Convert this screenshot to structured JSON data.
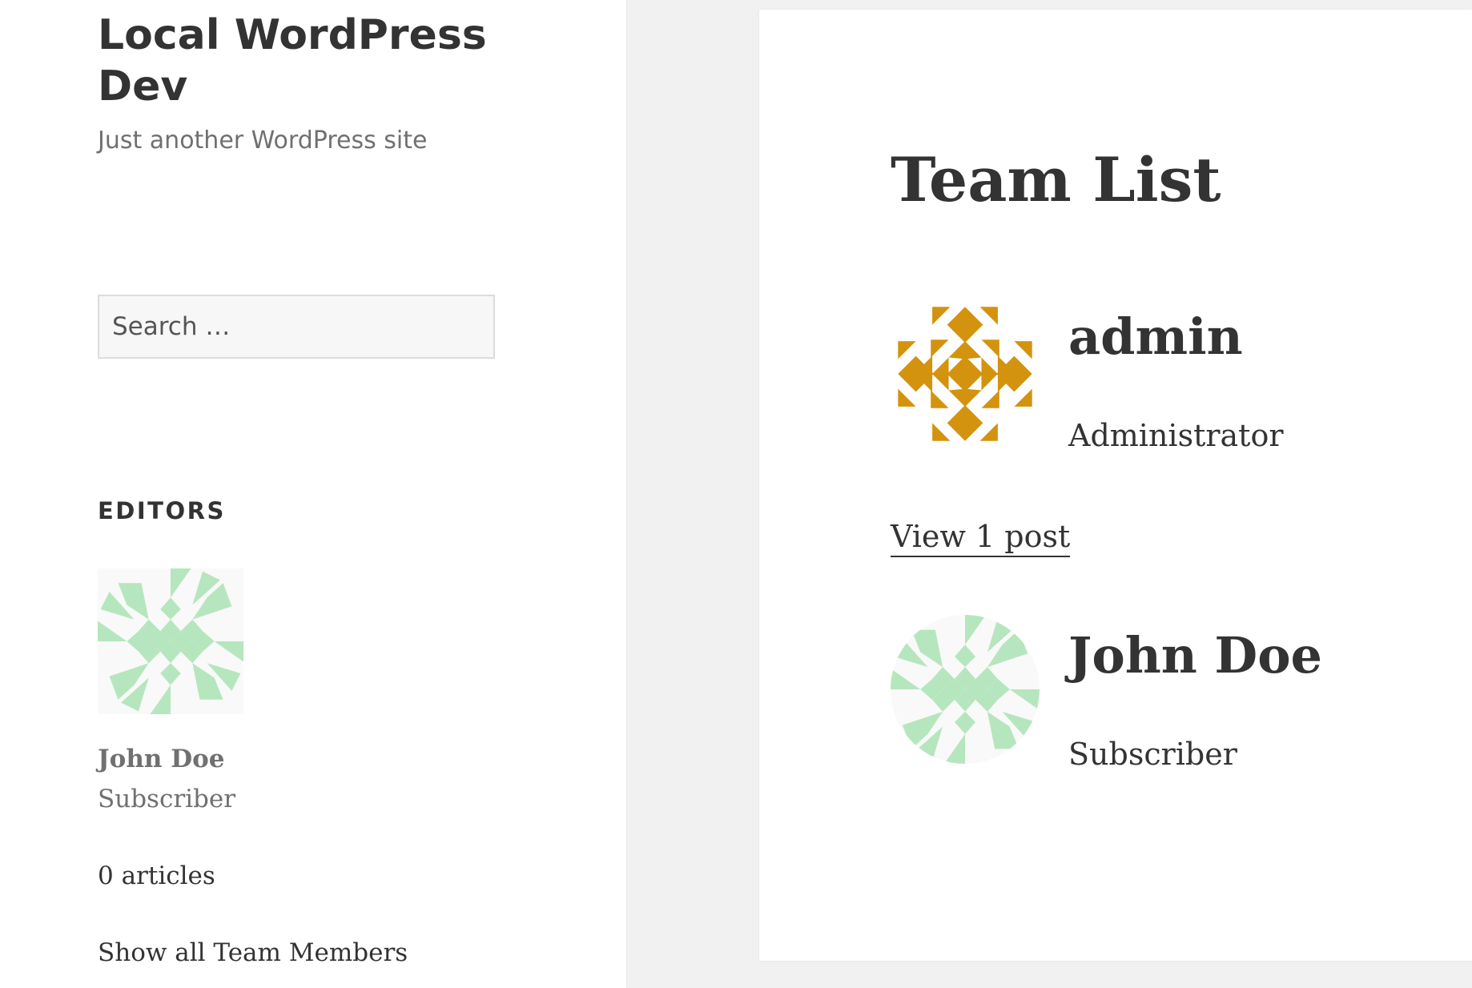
{
  "site": {
    "title": "Local WordPress Dev",
    "tagline": "Just another WordPress site"
  },
  "search": {
    "placeholder": "Search …"
  },
  "widget": {
    "title": "EDITORS",
    "member": {
      "name": "John Doe",
      "role": "Subscriber",
      "articles": "0 articles",
      "avatar_icon": "identicon-green-icon"
    },
    "show_all": "Show all Team Members"
  },
  "main": {
    "title": "Team List",
    "members": [
      {
        "name": "admin",
        "role": "Administrator",
        "posts_link": "View 1 post",
        "avatar_icon": "identicon-orange-icon",
        "avatar_color": "#d4930e"
      },
      {
        "name": "John Doe",
        "role": "Subscriber",
        "avatar_icon": "identicon-green-icon",
        "avatar_color": "#b6e6bd"
      }
    ]
  },
  "colors": {
    "text": "#333333",
    "muted": "#707070",
    "background": "#f1f1f1",
    "panel": "#ffffff"
  }
}
